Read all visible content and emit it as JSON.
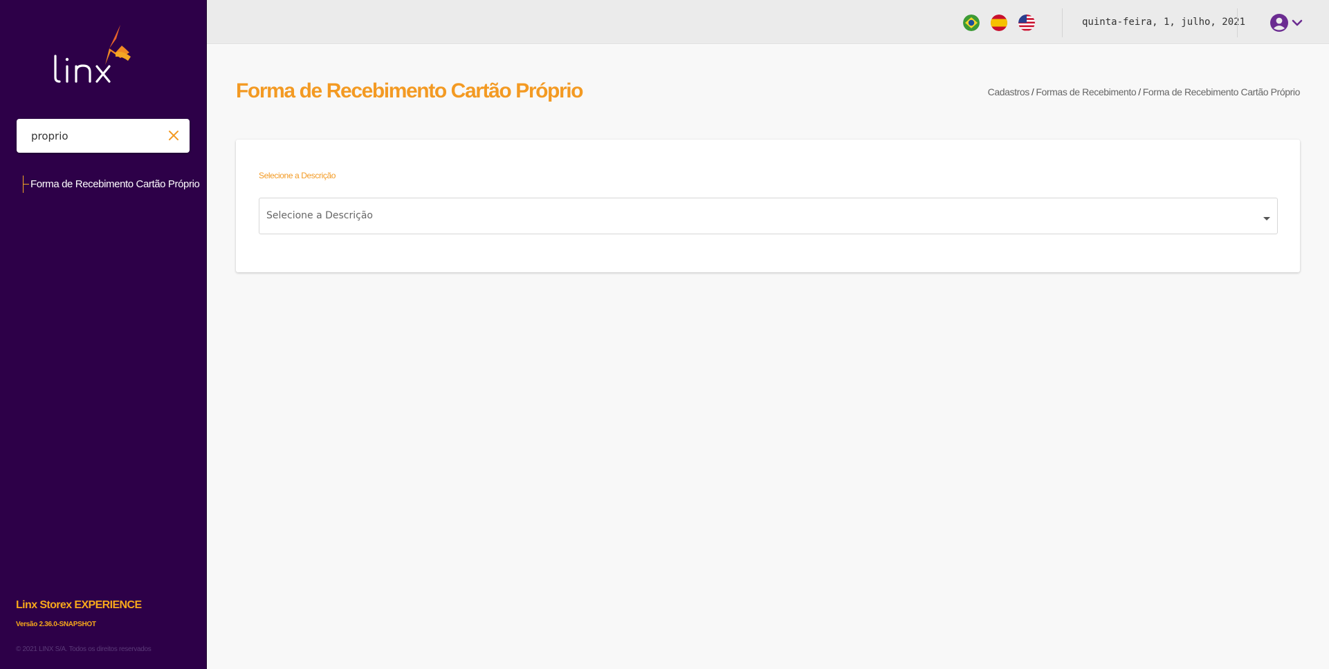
{
  "sidebar": {
    "logo_text": "linx",
    "search": {
      "value": "proprio",
      "placeholder": ""
    },
    "results": [
      {
        "label": "Forma de Recebimento Cartão Próprio"
      }
    ],
    "footer": {
      "app_name": "Linx Storex EXPERIENCE",
      "version": "Versão 2.36.0-SNAPSHOT",
      "copyright": "© 2021 LINX S/A. Todos os direitos reservados"
    }
  },
  "topbar": {
    "languages": [
      "pt-BR flag",
      "es flag",
      "en-US flag"
    ],
    "date": "quinta-feira, 1, julho, 2021",
    "user_icon": "user-circle-icon"
  },
  "page": {
    "title": "Forma de Recebimento Cartão Próprio",
    "breadcrumb": [
      "Cadastros",
      "Formas de Recebimento",
      "Forma de Recebimento Cartão Próprio"
    ],
    "breadcrumb_separator": "/"
  },
  "form": {
    "description_label": "Selecione a Descrição",
    "description_placeholder": "Selecione a Descrição"
  },
  "colors": {
    "sidebar_bg": "#2d0048",
    "accent_orange": "#f39a23",
    "user_purple": "#6b2c91"
  }
}
